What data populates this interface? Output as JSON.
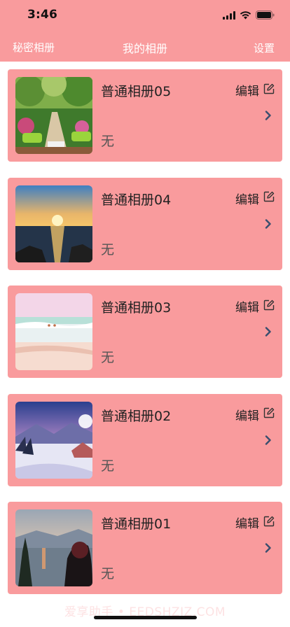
{
  "status_bar": {
    "time": "3:46",
    "icons": [
      "signal-icon",
      "wifi-icon",
      "battery-icon"
    ]
  },
  "nav": {
    "left": "秘密相册",
    "title": "我的相册",
    "right": "设置"
  },
  "albums": [
    {
      "name": "普通相册05",
      "desc": "无",
      "edit": "编辑",
      "thumb": "garden-photo"
    },
    {
      "name": "普通相册04",
      "desc": "无",
      "edit": "编辑",
      "thumb": "sunset-sea-photo"
    },
    {
      "name": "普通相册03",
      "desc": "无",
      "edit": "编辑",
      "thumb": "beach-photo"
    },
    {
      "name": "普通相册02",
      "desc": "无",
      "edit": "编辑",
      "thumb": "snow-mountain-photo"
    },
    {
      "name": "普通相册01",
      "desc": "无",
      "edit": "编辑",
      "thumb": "lake-dusk-photo"
    }
  ],
  "watermark": "爱享助手 • EEDSHZJZ.COM",
  "colors": {
    "header_bg": "#f99b9d",
    "card_bg": "#f99b9d",
    "chevron": "#3a4e6e"
  }
}
